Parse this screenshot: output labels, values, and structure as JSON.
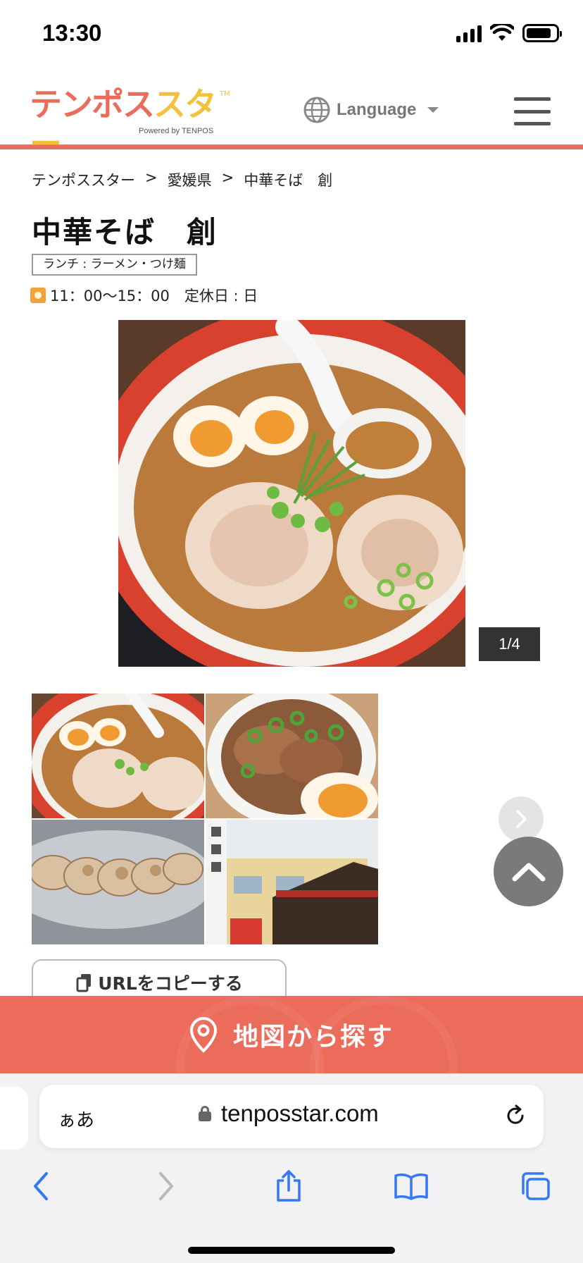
{
  "status_bar": {
    "time": "13:30",
    "battery_level": 0.85
  },
  "header": {
    "logo_text_part1": "テンポス",
    "logo_text_part2": "スター",
    "logo_tm": "TM",
    "logo_sub": "Powered by TENPOS",
    "language_label": "Language",
    "menu_icon": "hamburger-icon"
  },
  "breadcrumb": {
    "items": [
      "テンポススター",
      "愛媛県",
      "中華そば　創"
    ],
    "separator": ">"
  },
  "shop": {
    "name": "中華そば　創",
    "category": "ランチ : ラーメン・つけ麺",
    "hours": "11：00〜15：00　定休日 : 日"
  },
  "gallery": {
    "counter": "1/4",
    "thumbnails": [
      "ramen",
      "chashu-don",
      "gyoza",
      "storefront"
    ]
  },
  "actions": {
    "copy_url": "URLをコピーする",
    "map_search": "地図から探す"
  },
  "browser": {
    "aa_label": "ぁあ",
    "url": "tenposstar.com"
  },
  "colors": {
    "accent": "#ec6c5c",
    "logo_yellow": "#f3c13a",
    "safari_blue": "#3478f6"
  }
}
